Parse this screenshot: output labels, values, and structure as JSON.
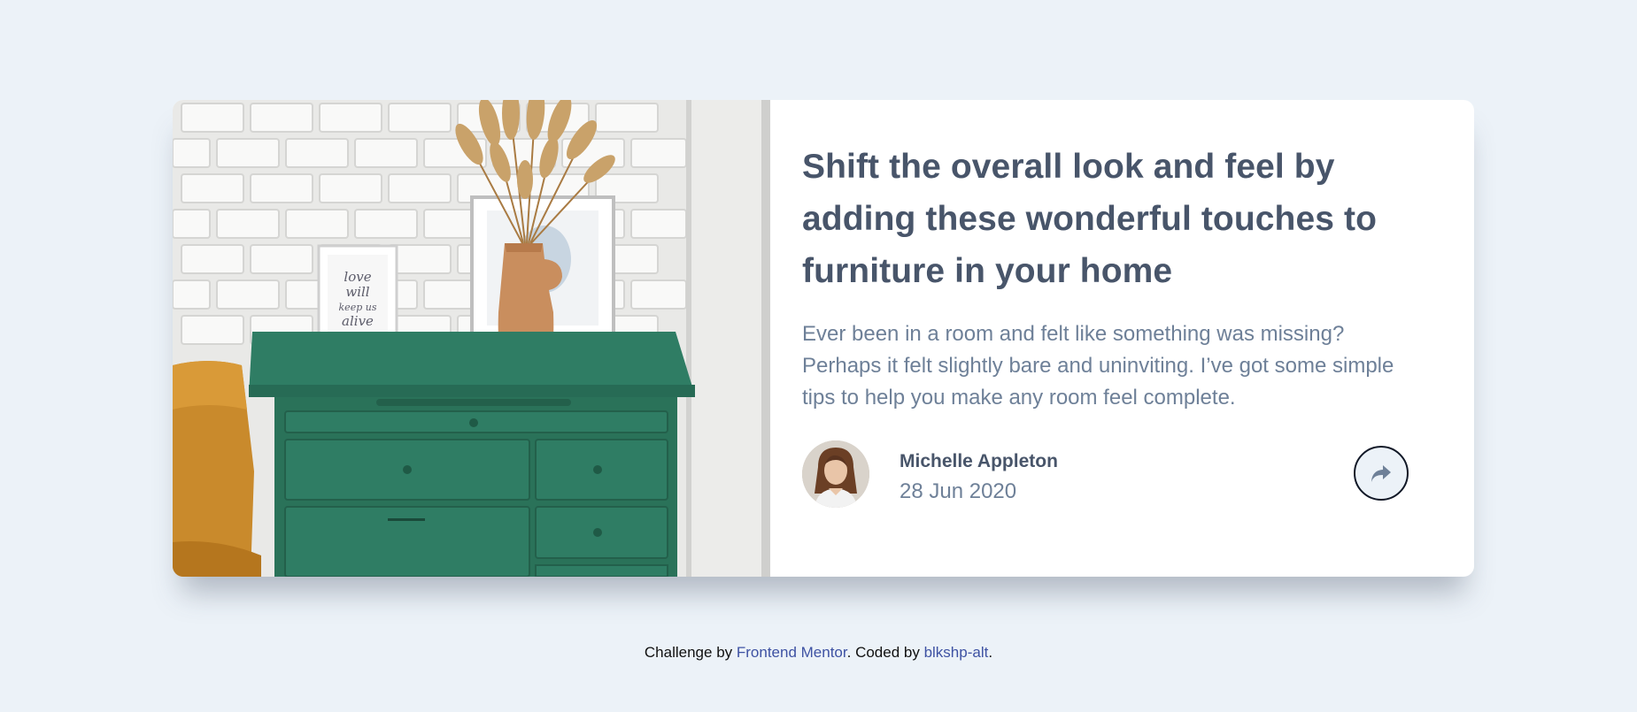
{
  "card": {
    "title": "Shift the overall look and feel by adding these wonderful touches to furniture in your home",
    "description": "Ever been in a room and felt like something was missing? Perhaps it felt slightly bare and uninviting. I’ve got some simple tips to help you make any room feel complete.",
    "image_alt": "drawers",
    "frame_text": "love will keep us alive",
    "author": {
      "name": "Michelle Appleton",
      "date": "28 Jun 2020",
      "avatar_icon": "avatar-photo"
    },
    "share_icon": "share-arrow-icon"
  },
  "attribution": {
    "prefix": "Challenge by ",
    "challenge_link": "Frontend Mentor",
    "middle": ". Coded by ",
    "coder_link": "blkshp-alt",
    "suffix": "."
  },
  "colors": {
    "background": "#ecf2f8",
    "heading": "#48556a",
    "body_text": "#6e8098",
    "link": "#3e52a3",
    "drawer_green": "#2f7d64"
  }
}
